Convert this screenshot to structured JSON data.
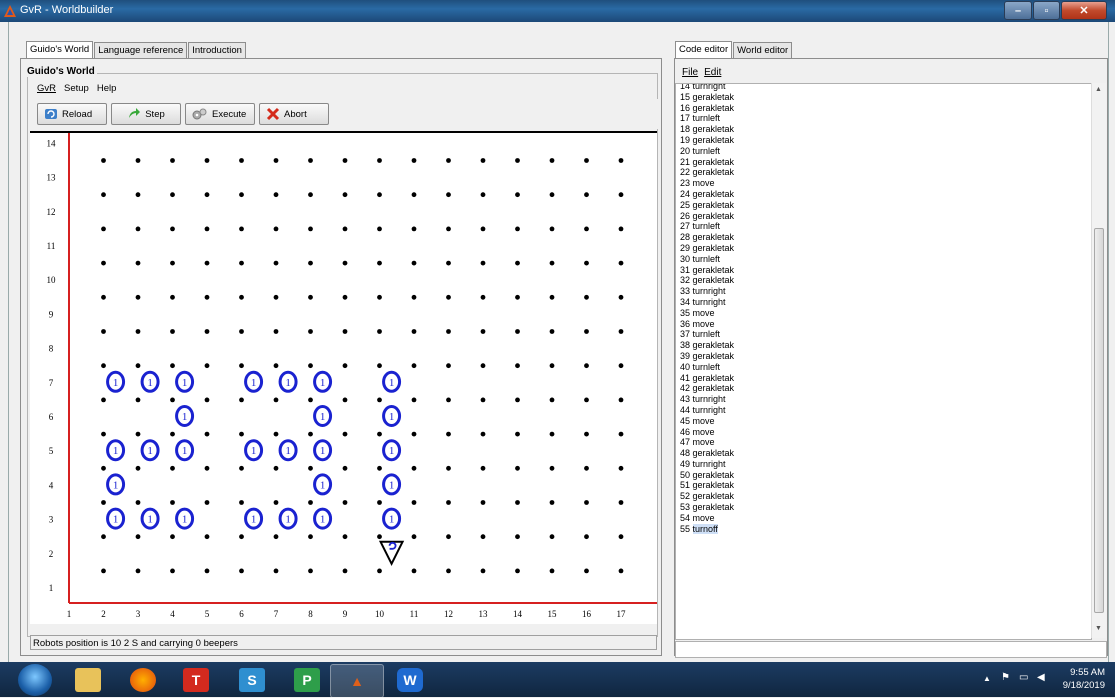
{
  "window": {
    "title": "GvR - Worldbuilder"
  },
  "left_tabs": [
    "Guido's World",
    "Language reference",
    "Introduction"
  ],
  "right_tabs": [
    "Code editor",
    "World editor"
  ],
  "guido": {
    "group_label": "Guido's World",
    "menu": [
      "GvR",
      "Setup",
      "Help"
    ],
    "toolbar": {
      "reload": "Reload",
      "step": "Step",
      "execute": "Execute",
      "abort": "Abort"
    }
  },
  "world": {
    "x_ticks": [
      "1",
      "2",
      "3",
      "4",
      "5",
      "6",
      "7",
      "8",
      "9",
      "10",
      "11",
      "12",
      "13",
      "14",
      "15",
      "16",
      "17"
    ],
    "y_ticks": [
      "1",
      "2",
      "3",
      "4",
      "5",
      "6",
      "7",
      "8",
      "9",
      "10",
      "11",
      "12",
      "13",
      "14"
    ],
    "beepers": [
      {
        "x": 2,
        "y": 7,
        "n": 1
      },
      {
        "x": 3,
        "y": 7,
        "n": 1
      },
      {
        "x": 4,
        "y": 7,
        "n": 1
      },
      {
        "x": 6,
        "y": 7,
        "n": 1
      },
      {
        "x": 7,
        "y": 7,
        "n": 1
      },
      {
        "x": 8,
        "y": 7,
        "n": 1
      },
      {
        "x": 10,
        "y": 7,
        "n": 1
      },
      {
        "x": 4,
        "y": 6,
        "n": 1
      },
      {
        "x": 8,
        "y": 6,
        "n": 1
      },
      {
        "x": 10,
        "y": 6,
        "n": 1
      },
      {
        "x": 2,
        "y": 5,
        "n": 1
      },
      {
        "x": 3,
        "y": 5,
        "n": 1
      },
      {
        "x": 4,
        "y": 5,
        "n": 1
      },
      {
        "x": 6,
        "y": 5,
        "n": 1
      },
      {
        "x": 7,
        "y": 5,
        "n": 1
      },
      {
        "x": 8,
        "y": 5,
        "n": 1
      },
      {
        "x": 10,
        "y": 5,
        "n": 1
      },
      {
        "x": 2,
        "y": 4,
        "n": 1
      },
      {
        "x": 8,
        "y": 4,
        "n": 1
      },
      {
        "x": 10,
        "y": 4,
        "n": 1
      },
      {
        "x": 2,
        "y": 3,
        "n": 1
      },
      {
        "x": 3,
        "y": 3,
        "n": 1
      },
      {
        "x": 4,
        "y": 3,
        "n": 1
      },
      {
        "x": 6,
        "y": 3,
        "n": 1
      },
      {
        "x": 7,
        "y": 3,
        "n": 1
      },
      {
        "x": 8,
        "y": 3,
        "n": 1
      },
      {
        "x": 10,
        "y": 3,
        "n": 1
      }
    ],
    "robot": {
      "x": 10,
      "y": 2,
      "dir": "S"
    },
    "wall_color": "#d62020",
    "beeper_color": "#1a22d0"
  },
  "status": "Robots position is 10 2 S and carrying 0 beepers",
  "editor": {
    "menu": [
      "File",
      "Edit"
    ],
    "lines": [
      {
        "n": "14",
        "t": "turnright"
      },
      {
        "n": "15",
        "t": "gerakletak"
      },
      {
        "n": "16",
        "t": "gerakletak"
      },
      {
        "n": "17",
        "t": "turnleft"
      },
      {
        "n": "18",
        "t": "gerakletak"
      },
      {
        "n": "19",
        "t": "gerakletak"
      },
      {
        "n": "20",
        "t": "turnleft"
      },
      {
        "n": "21",
        "t": "gerakletak"
      },
      {
        "n": "22",
        "t": "gerakletak"
      },
      {
        "n": "23",
        "t": "move"
      },
      {
        "n": "24",
        "t": "gerakletak"
      },
      {
        "n": "25",
        "t": "gerakletak"
      },
      {
        "n": "26",
        "t": "gerakletak"
      },
      {
        "n": "27",
        "t": "turnleft"
      },
      {
        "n": "28",
        "t": "gerakletak"
      },
      {
        "n": "29",
        "t": "gerakletak"
      },
      {
        "n": "30",
        "t": "turnleft"
      },
      {
        "n": "31",
        "t": "gerakletak"
      },
      {
        "n": "32",
        "t": "gerakletak"
      },
      {
        "n": "33",
        "t": "turnright"
      },
      {
        "n": "34",
        "t": "turnright"
      },
      {
        "n": "35",
        "t": "move"
      },
      {
        "n": "36",
        "t": "move"
      },
      {
        "n": "37",
        "t": "turnleft"
      },
      {
        "n": "38",
        "t": "gerakletak"
      },
      {
        "n": "39",
        "t": "gerakletak"
      },
      {
        "n": "40",
        "t": "turnleft"
      },
      {
        "n": "41",
        "t": "gerakletak"
      },
      {
        "n": "42",
        "t": "gerakletak"
      },
      {
        "n": "43",
        "t": "turnright"
      },
      {
        "n": "44",
        "t": "turnright"
      },
      {
        "n": "45",
        "t": "move"
      },
      {
        "n": "46",
        "t": "move"
      },
      {
        "n": "47",
        "t": "move"
      },
      {
        "n": "48",
        "t": "gerakletak"
      },
      {
        "n": "49",
        "t": "turnright"
      },
      {
        "n": "50",
        "t": "gerakletak"
      },
      {
        "n": "51",
        "t": "gerakletak"
      },
      {
        "n": "52",
        "t": "gerakletak"
      },
      {
        "n": "53",
        "t": "gerakletak"
      },
      {
        "n": "54",
        "t": "move"
      },
      {
        "n": "55",
        "t": "turnoff"
      }
    ],
    "current_line": "55"
  },
  "taskbar": {
    "apps": [
      "file-explorer",
      "firefox",
      "foxit-reader",
      "wps-spreadsheets",
      "wps-presentation",
      "gvr",
      "wps-writer"
    ],
    "time": "9:55 AM",
    "date": "9/18/2019"
  }
}
